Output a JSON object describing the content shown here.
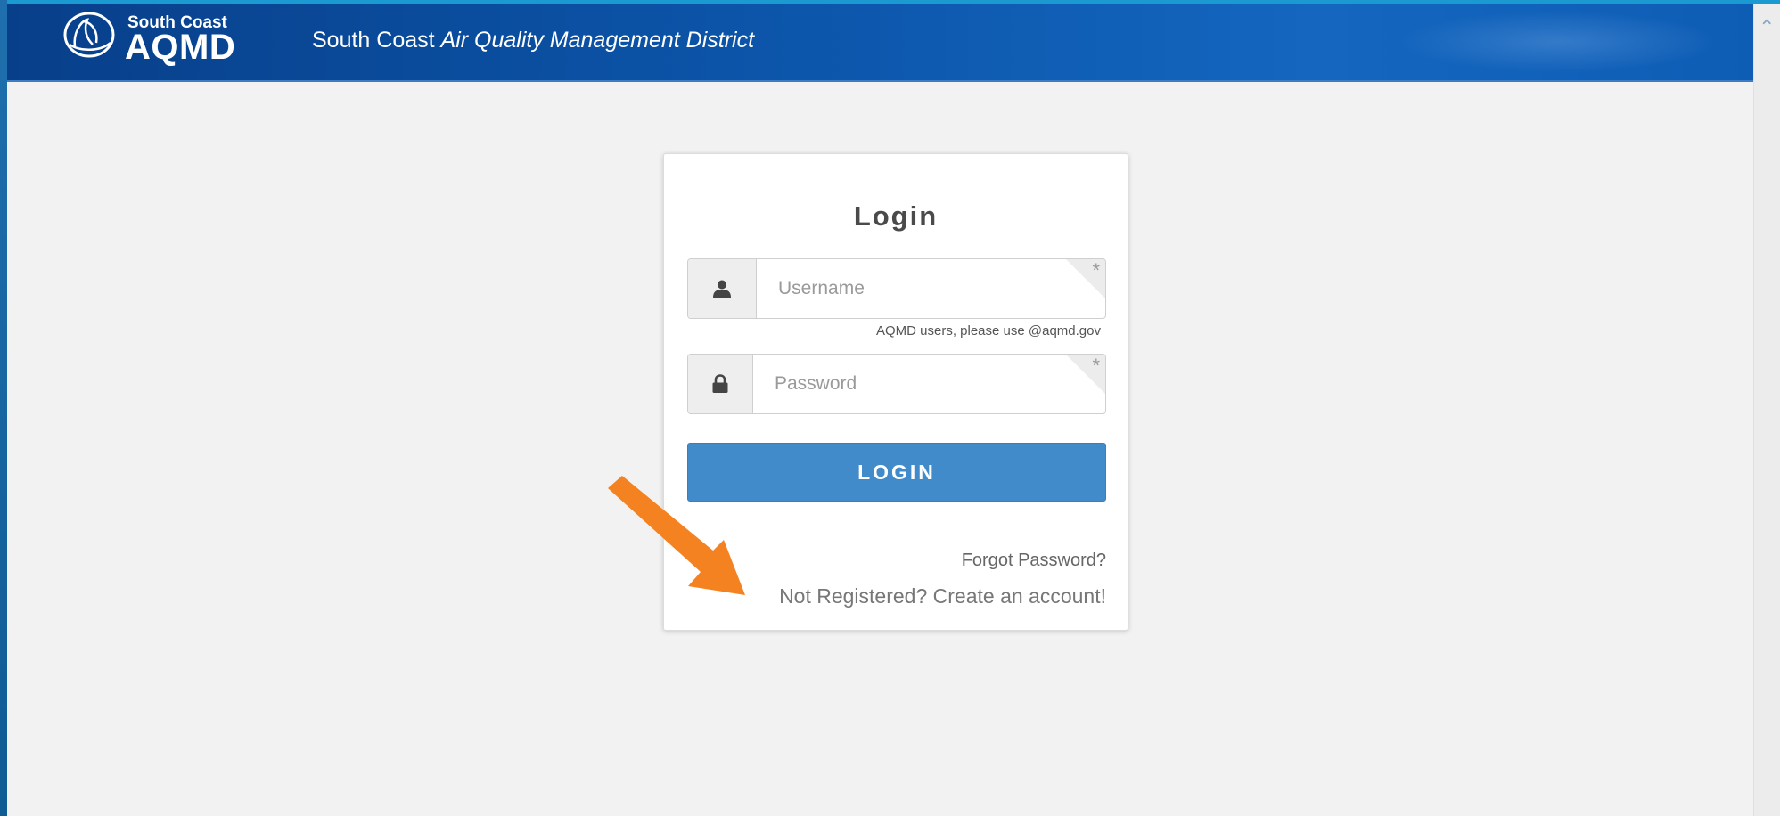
{
  "header": {
    "logo_small": "South Coast",
    "logo_big": "AQMD",
    "title_plain": "South Coast",
    "title_italic": "Air Quality Management District",
    "logo_icon": "aqmd-wave-circle-icon"
  },
  "login": {
    "title": "Login",
    "username_placeholder": "Username",
    "username_icon": "user-icon",
    "username_hint": "AQMD users, please use @aqmd.gov",
    "password_placeholder": "Password",
    "password_icon": "lock-icon",
    "required_marker": "*",
    "button_label": "LOGIN",
    "forgot_link": "Forgot Password?",
    "register_link": "Not Registered? Create an account!"
  },
  "annotation": {
    "arrow_color": "#f58220",
    "arrow_icon": "callout-arrow-icon"
  },
  "colors": {
    "header_blue": "#0c56ab",
    "button_blue": "#428bca",
    "page_background": "#f2f2f2"
  },
  "scrollbar": {
    "up_icon": "chevron-up-icon"
  }
}
